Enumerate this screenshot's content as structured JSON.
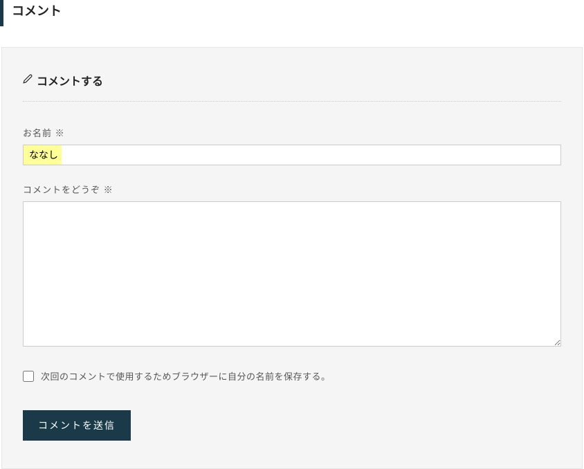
{
  "header": {
    "title": "コメント"
  },
  "form": {
    "reply_title": "コメントする",
    "name": {
      "label": "お名前",
      "required_mark": "※",
      "value": "ななし"
    },
    "comment": {
      "label": "コメントをどうぞ",
      "required_mark": "※",
      "value": ""
    },
    "save_checkbox": {
      "label": "次回のコメントで使用するためブラウザーに自分の名前を保存する。",
      "checked": false
    },
    "submit_label": "コメントを送信"
  }
}
